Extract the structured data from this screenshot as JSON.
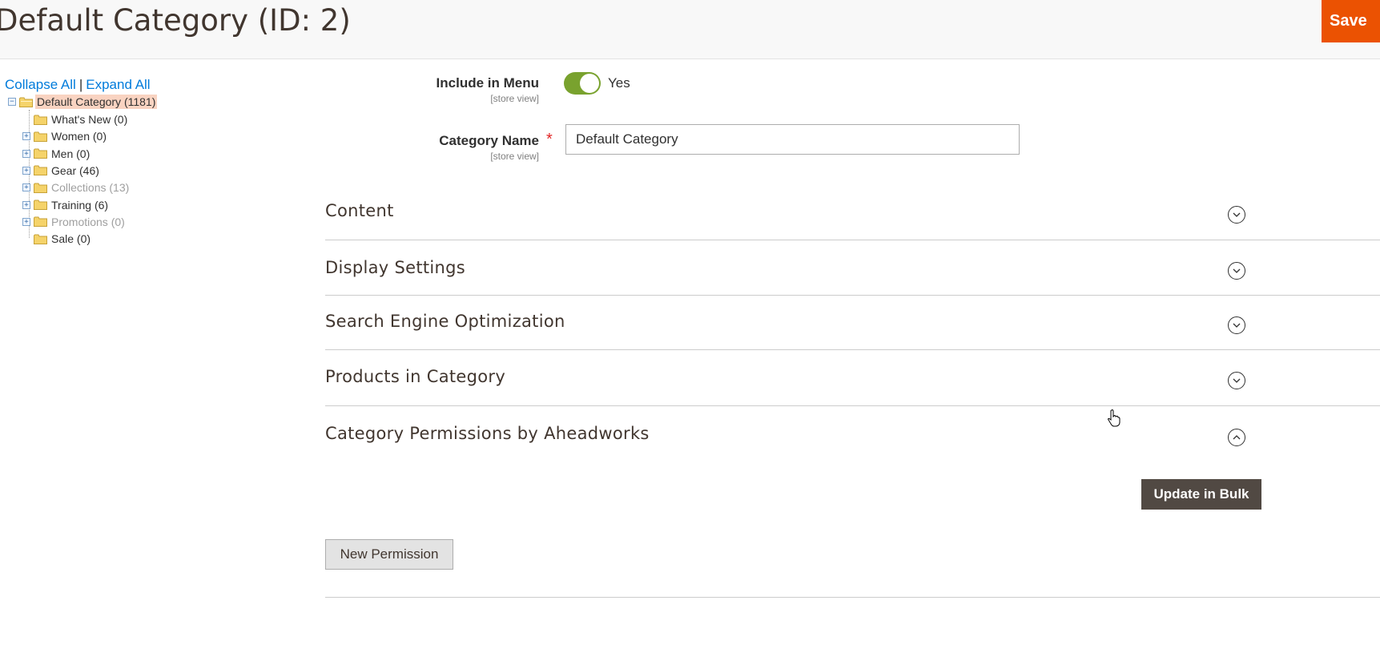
{
  "header": {
    "title": "Default Category (ID: 2)",
    "save_label": "Save"
  },
  "tree": {
    "collapse_all": "Collapse All",
    "separator": "|",
    "expand_all": "Expand All",
    "root": {
      "label": "Default Category (1181)"
    },
    "children": [
      {
        "label": "What's New (0)",
        "expandable": false,
        "muted": false
      },
      {
        "label": "Women (0)",
        "expandable": true,
        "muted": false
      },
      {
        "label": "Men (0)",
        "expandable": true,
        "muted": false
      },
      {
        "label": "Gear (46)",
        "expandable": true,
        "muted": false
      },
      {
        "label": "Collections (13)",
        "expandable": true,
        "muted": true
      },
      {
        "label": "Training (6)",
        "expandable": true,
        "muted": false
      },
      {
        "label": "Promotions (0)",
        "expandable": true,
        "muted": true
      },
      {
        "label": "Sale (0)",
        "expandable": false,
        "muted": false
      }
    ]
  },
  "form": {
    "include_in_menu": {
      "label": "Include in Menu",
      "scope": "[store view]",
      "value": "Yes"
    },
    "category_name": {
      "label": "Category Name",
      "scope": "[store view]",
      "value": "Default Category",
      "required_mark": "*"
    }
  },
  "sections": [
    {
      "title": "Content",
      "expanded": false
    },
    {
      "title": "Display Settings",
      "expanded": false
    },
    {
      "title": "Search Engine Optimization",
      "expanded": false
    },
    {
      "title": "Products in Category",
      "expanded": false
    },
    {
      "title": "Category Permissions by Aheadworks",
      "expanded": true
    }
  ],
  "permissions": {
    "bulk_label": "Update in Bulk",
    "new_label": "New Permission"
  },
  "colors": {
    "accent": "#eb5202",
    "toggle_on": "#79a22e",
    "link": "#007bdb",
    "selected": "#f9d3c1"
  }
}
